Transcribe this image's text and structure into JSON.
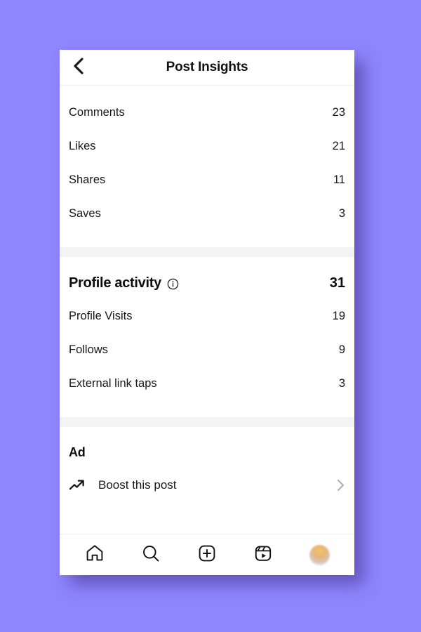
{
  "background_color": "#8f86ff",
  "header": {
    "back_icon": "chevron-left-icon",
    "title": "Post Insights"
  },
  "engagement": {
    "rows": [
      {
        "label": "Comments",
        "value": "23"
      },
      {
        "label": "Likes",
        "value": "21"
      },
      {
        "label": "Shares",
        "value": "11"
      },
      {
        "label": "Saves",
        "value": "3"
      }
    ]
  },
  "profile_activity": {
    "title": "Profile activity",
    "info_icon": "info-circle-icon",
    "total": "31",
    "rows": [
      {
        "label": "Profile Visits",
        "value": "19"
      },
      {
        "label": "Follows",
        "value": "9"
      },
      {
        "label": "External link taps",
        "value": "3"
      }
    ]
  },
  "ad": {
    "title": "Ad",
    "boost": {
      "icon": "trending-up-icon",
      "label": "Boost this post",
      "chevron": "chevron-right-icon"
    }
  },
  "navbar": {
    "items": [
      {
        "icon": "home-icon",
        "name": "nav-home"
      },
      {
        "icon": "search-icon",
        "name": "nav-search"
      },
      {
        "icon": "plus-square-icon",
        "name": "nav-create"
      },
      {
        "icon": "reels-icon",
        "name": "nav-reels"
      },
      {
        "icon": "avatar-icon",
        "name": "nav-profile"
      }
    ]
  }
}
